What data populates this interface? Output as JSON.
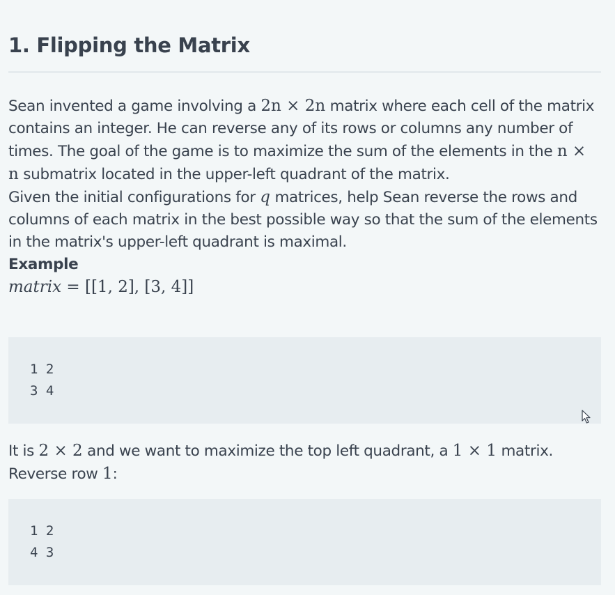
{
  "title": "1. Flipping the Matrix",
  "description": {
    "p1_a": "Sean invented a game involving a ",
    "p1_m1": "2n × 2n",
    "p1_b": " matrix where each cell of the matrix contains an integer. He can reverse any of its rows or columns any number of times. The goal of the game is to maximize the sum of the elements in the ",
    "p1_m2": "n × n",
    "p1_c": " submatrix located in the upper-left quadrant of the matrix.",
    "p2_a": "Given the initial configurations for ",
    "p2_m1": "q",
    "p2_b": " matrices, help Sean reverse the rows and columns of each matrix in the best possible way so that the sum of the elements in the matrix's upper-left quadrant is maximal.",
    "example_heading": "Example",
    "example_lhs": "matrix",
    "example_rhs": " = [[1, 2], [3, 4]]"
  },
  "code_block_1": {
    "lines": [
      "1 2",
      "3 4"
    ]
  },
  "after": {
    "p3_a": "It is ",
    "p3_m1": "2 × 2",
    "p3_b": " and we want to maximize the top left quadrant, a ",
    "p3_m2": "1 × 1",
    "p3_c": " matrix.",
    "p4_a": "Reverse row ",
    "p4_m1": "1",
    "p4_b": ":"
  },
  "code_block_2": {
    "lines": [
      "1 2",
      "4 3"
    ]
  },
  "icons": {
    "cursor": "mouse-pointer-icon"
  }
}
